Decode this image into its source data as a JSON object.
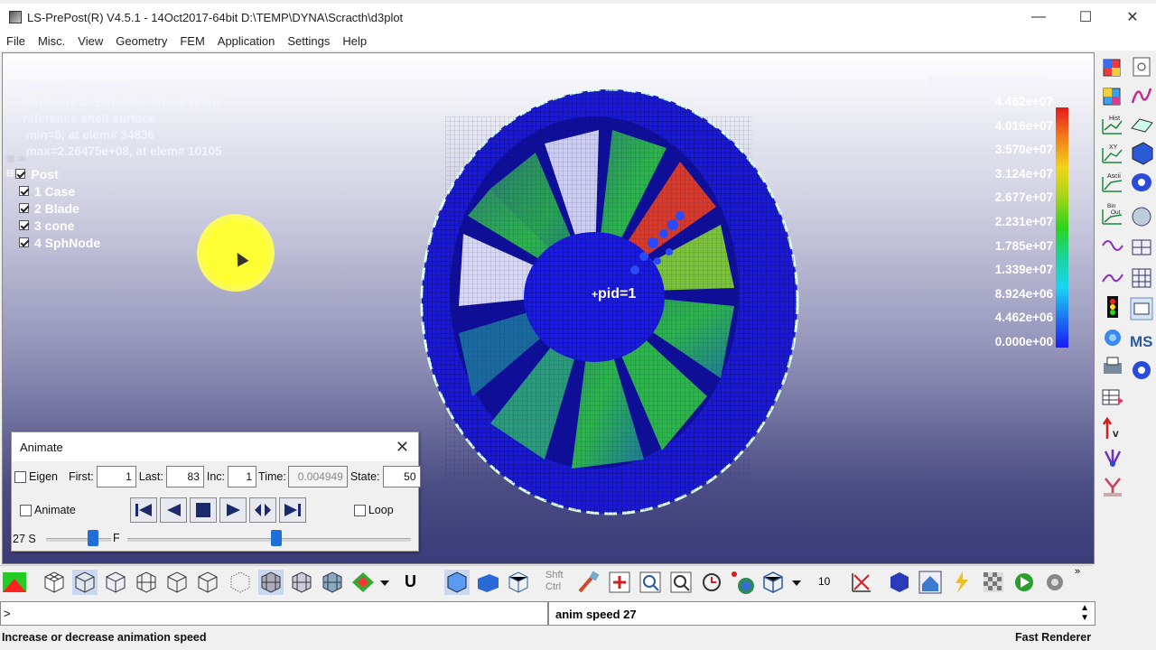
{
  "window": {
    "title": "LS-PrePost(R) V4.5.1 - 14Oct2017-64bit D:\\TEMP\\DYNA\\Scracth\\d3plot",
    "minimize": "—",
    "maximize": "☐",
    "close": "✕"
  },
  "menu": [
    "File",
    "Misc.",
    "View",
    "Geometry",
    "FEM",
    "Application",
    "Settings",
    "Help"
  ],
  "viewport": {
    "info_lines": [
      "Time =    0.004848",
      "Contours of Effective Stress (v-m)",
      "reference shell surface",
      " min=0, at elem# 34836",
      " max=2.26475e+08, at elem# 10105"
    ],
    "tree": {
      "root": "Post",
      "items": [
        "1 Case",
        "2 Blade",
        "3 cone",
        "4 SphNode"
      ]
    },
    "part_label": "pid=1",
    "legend": {
      "title": "Effective Stress (v-m)",
      "values": [
        "4.462e+07",
        "4.016e+07",
        "3.570e+07",
        "3.124e+07",
        "2.677e+07",
        "2.231e+07",
        "1.785e+07",
        "1.339e+07",
        "8.924e+06",
        "4.462e+06",
        "0.000e+00"
      ],
      "colors": [
        "#e41a1a",
        "#f07a1a",
        "#f2d41a",
        "#a8d41a",
        "#2cd41a",
        "#1ad49a",
        "#1ad4f2",
        "#1a7af2",
        "#1a1af2"
      ]
    }
  },
  "animate": {
    "title": "Animate",
    "close": "✕",
    "eigen_label": "Eigen",
    "first_label": "First:",
    "first": "1",
    "last_label": "Last:",
    "last": "83",
    "inc_label": "Inc:",
    "inc": "1",
    "time_label": "Time:",
    "time": "0.004949",
    "state_label": "State:",
    "state": "50",
    "animate_label": "Animate",
    "loop_label": "Loop",
    "speed_label": "27 S",
    "frame_label": "F",
    "speed": 27
  },
  "toolbar_bottom": {
    "number": "10",
    "shft": "Shft",
    "ctrl": "Ctrl",
    "u_label": "U"
  },
  "command": {
    "prompt": ">",
    "output": "anim speed 27"
  },
  "status": {
    "message": "Increase or decrease animation speed",
    "renderer": "Fast Renderer"
  }
}
